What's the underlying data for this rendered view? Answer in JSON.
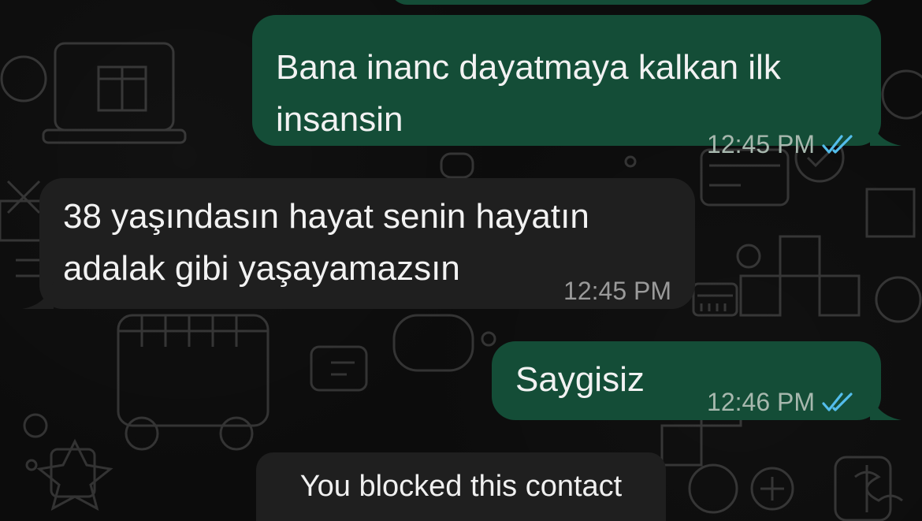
{
  "chat": {
    "messages": [
      {
        "direction": "outgoing",
        "lines": [
          "Bana inanc dayatmaya kalkan ilk",
          "insansin"
        ],
        "time": "12:45 PM",
        "status": "read"
      },
      {
        "direction": "incoming",
        "lines": [
          "38 yaşındasın hayat senin hayatın",
          "adalak gibi yaşayamazsın"
        ],
        "time": "12:45 PM"
      },
      {
        "direction": "outgoing",
        "lines": [
          "Saygisiz"
        ],
        "time": "12:46 PM",
        "status": "read"
      }
    ],
    "system_notice": "You blocked this contact"
  },
  "colors": {
    "background": "#0c0c0c",
    "outgoing_bubble": "#144d37",
    "incoming_bubble": "#1f1f1f",
    "read_ticks": "#53bdeb"
  },
  "icons": {
    "read_receipt": "double-check-icon"
  }
}
